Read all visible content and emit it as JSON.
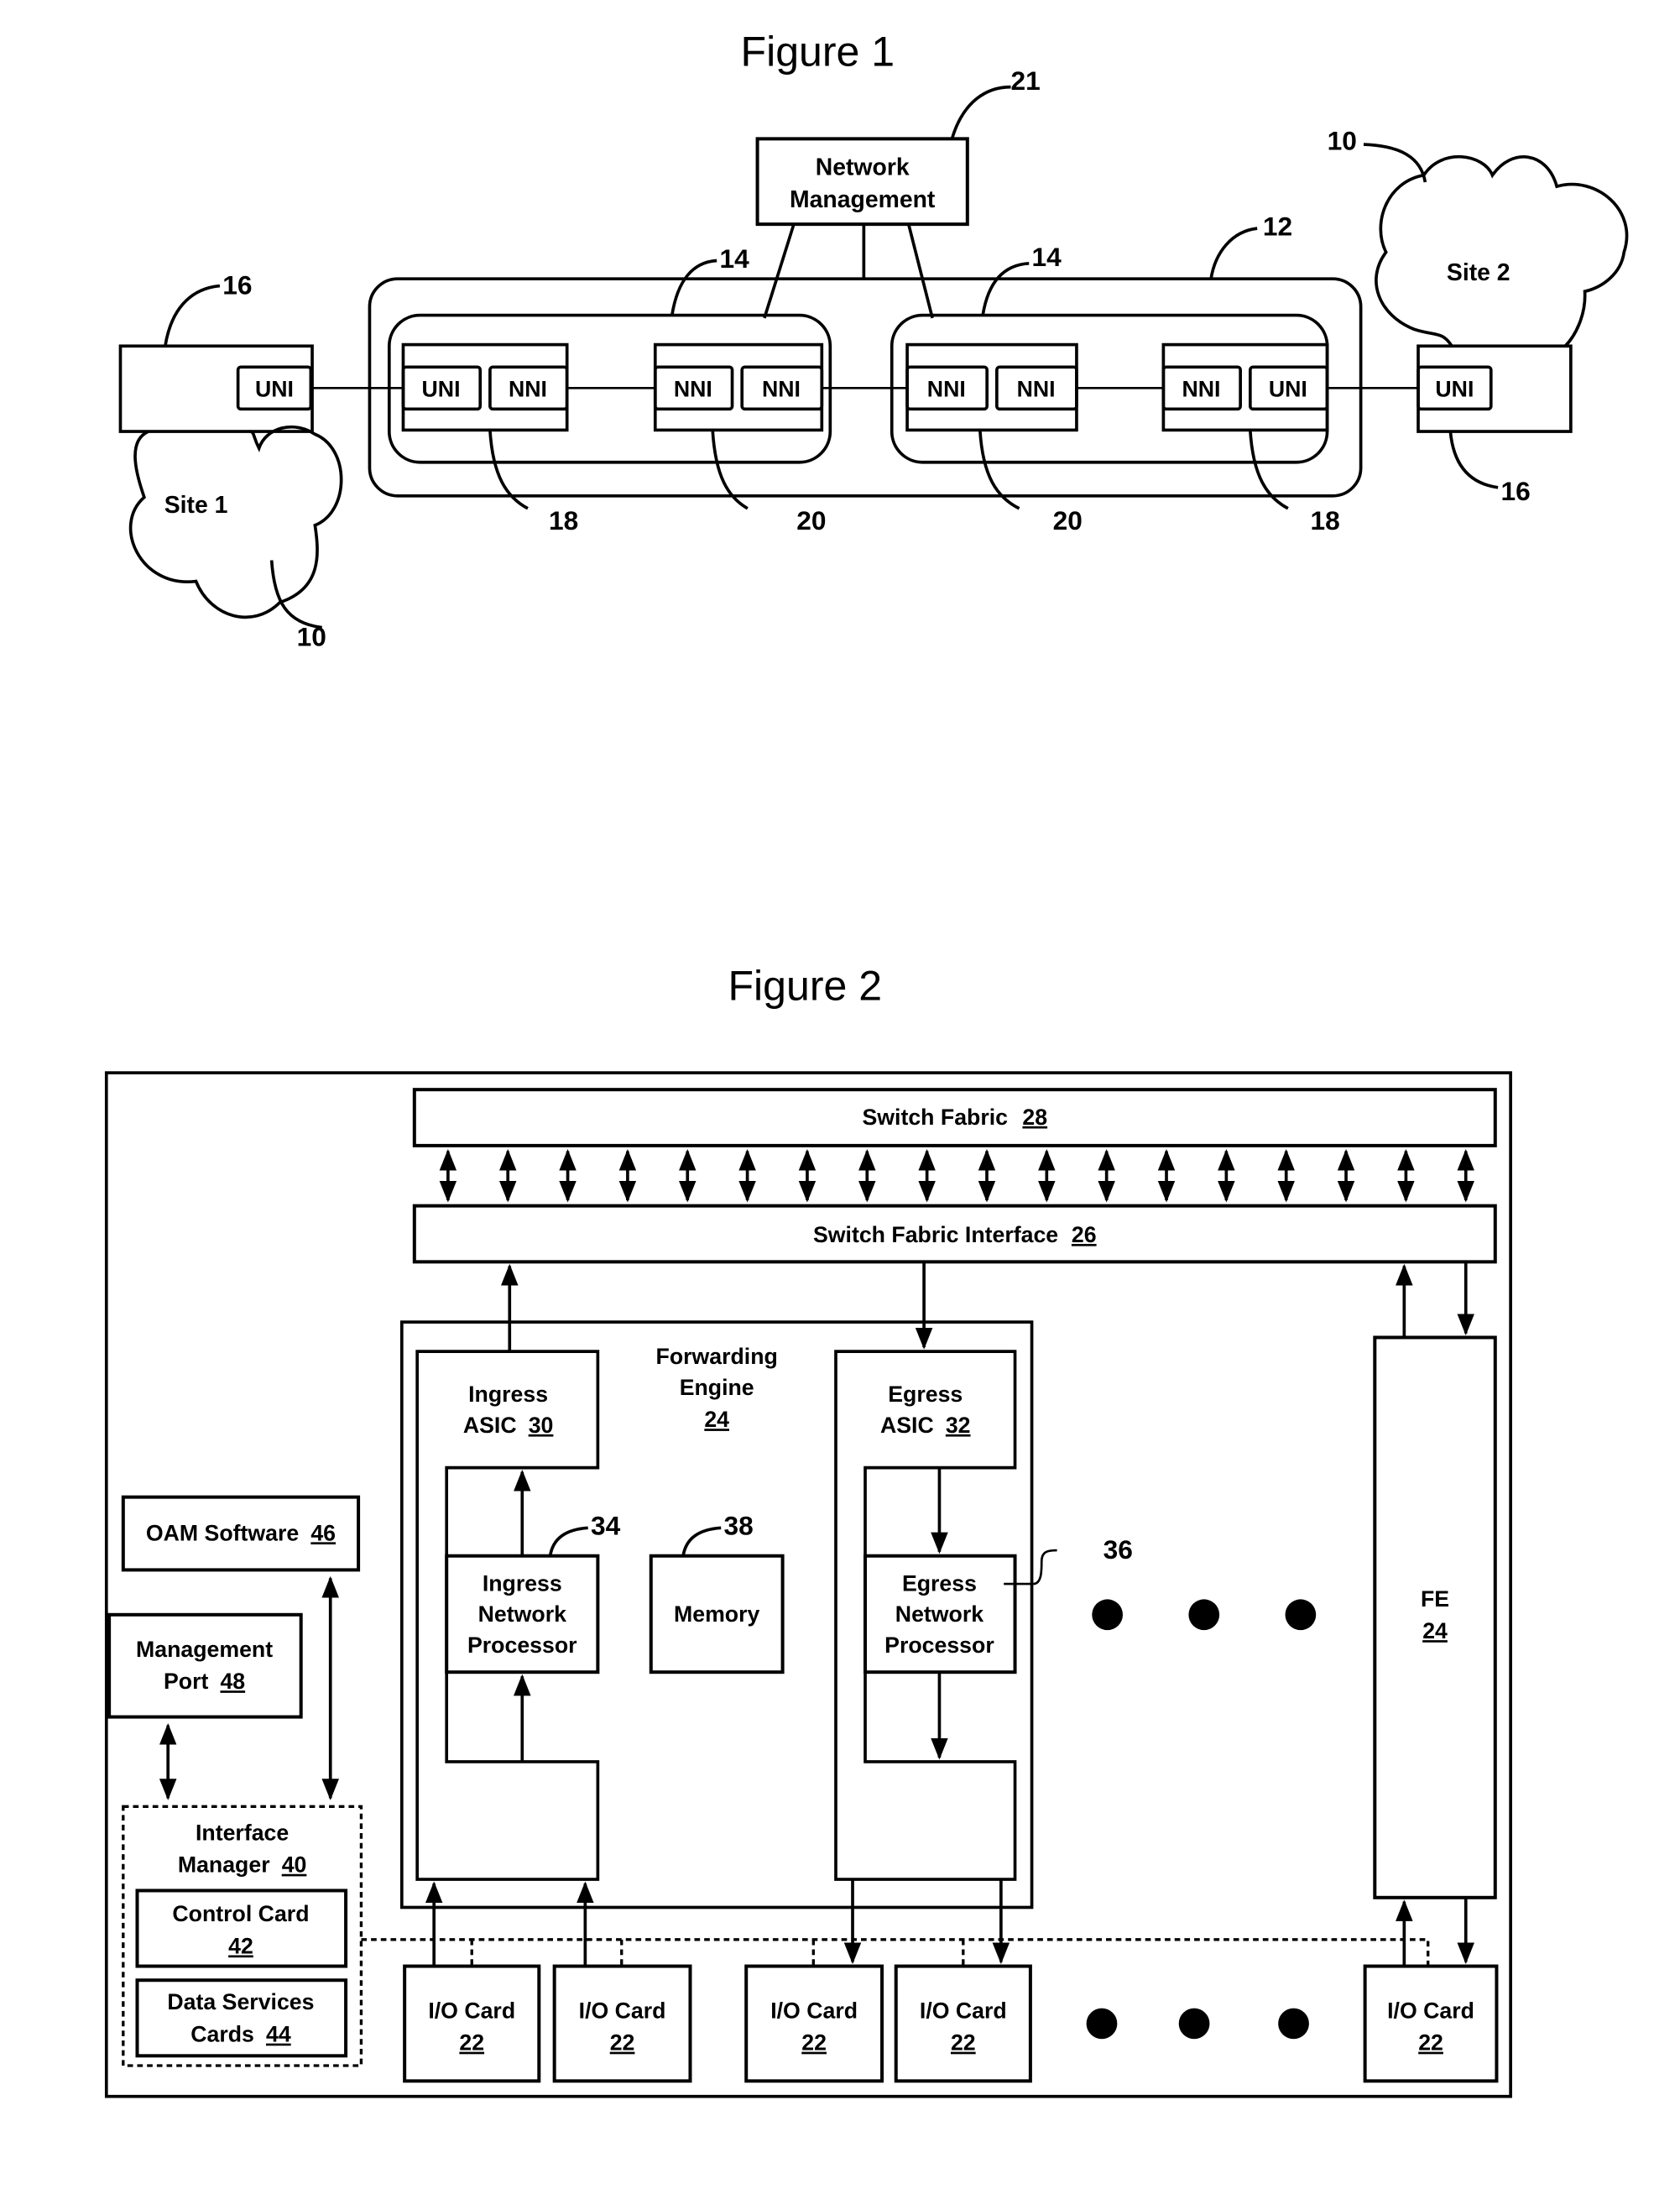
{
  "figure1": {
    "title": "Figure 1",
    "network_management": {
      "line1": "Network",
      "line2": "Management",
      "ref": "21"
    },
    "site1": {
      "label": "Site 1",
      "ref": "10"
    },
    "site2": {
      "label": "Site 2",
      "ref": "10"
    },
    "ce_left": {
      "port": "UNI",
      "ref": "16"
    },
    "ce_right": {
      "port": "UNI",
      "ref": "16"
    },
    "provider_network_ref": "12",
    "domains": [
      {
        "ref": "14",
        "nodes": [
          {
            "ports": [
              "UNI",
              "NNI"
            ],
            "ref": "18"
          },
          {
            "ports": [
              "NNI",
              "NNI"
            ],
            "ref": "20"
          }
        ]
      },
      {
        "ref": "14",
        "nodes": [
          {
            "ports": [
              "NNI",
              "NNI"
            ],
            "ref": "20"
          },
          {
            "ports": [
              "NNI",
              "UNI"
            ],
            "ref": "18"
          }
        ]
      }
    ]
  },
  "figure2": {
    "title": "Figure 2",
    "switch_fabric": {
      "label": "Switch Fabric",
      "ref": "28"
    },
    "switch_fabric_interface": {
      "label": "Switch Fabric Interface",
      "ref": "26"
    },
    "forwarding_engine": {
      "line1": "Forwarding",
      "line2": "Engine",
      "ref": "24"
    },
    "ingress_asic": {
      "line1": "Ingress",
      "line2": "ASIC",
      "ref": "30"
    },
    "egress_asic": {
      "line1": "Egress",
      "line2": "ASIC",
      "ref": "32"
    },
    "ingress_np": {
      "line1": "Ingress",
      "line2": "Network",
      "line3": "Processor",
      "ref": "34"
    },
    "egress_np": {
      "line1": "Egress",
      "line2": "Network",
      "line3": "Processor",
      "ref": "36"
    },
    "memory": {
      "label": "Memory",
      "ref": "38"
    },
    "fe": {
      "label": "FE",
      "ref": "24"
    },
    "oam_software": {
      "label": "OAM Software",
      "ref": "46"
    },
    "management_port": {
      "line1": "Management",
      "line2": "Port",
      "ref": "48"
    },
    "interface_manager": {
      "line1": "Interface",
      "line2": "Manager",
      "ref": "40"
    },
    "control_card": {
      "label": "Control Card",
      "ref": "42"
    },
    "data_services_cards": {
      "line1": "Data Services",
      "line2": "Cards",
      "ref": "44"
    },
    "io_cards": [
      {
        "label": "I/O Card",
        "ref": "22"
      },
      {
        "label": "I/O Card",
        "ref": "22"
      },
      {
        "label": "I/O Card",
        "ref": "22"
      },
      {
        "label": "I/O Card",
        "ref": "22"
      },
      {
        "label": "I/O Card",
        "ref": "22"
      }
    ],
    "fabric_link_count": 18
  }
}
